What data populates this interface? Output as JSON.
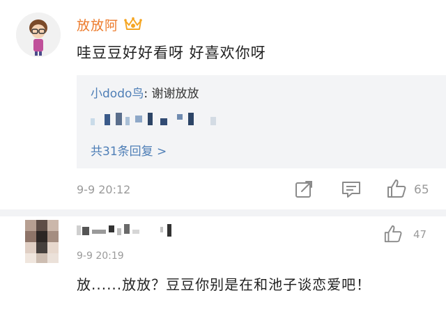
{
  "comments": [
    {
      "username": "放放阿",
      "text": "哇豆豆好好看呀 好喜欢你呀",
      "reply": {
        "name": "小dodo鸟",
        "separator": ": ",
        "text": "谢谢放放",
        "more": "共31条回复 >"
      },
      "time": "9-9 20:12",
      "likes": "65"
    },
    {
      "time": "9-9 20:19",
      "likes": "47",
      "text": "放......放放？豆豆你别是在和池子谈恋爱吧！"
    }
  ],
  "colors": {
    "username": "#ec7a2b",
    "link": "#4e7eb6",
    "meta": "#9a9a9a",
    "reply_bg": "#f3f4f6"
  }
}
